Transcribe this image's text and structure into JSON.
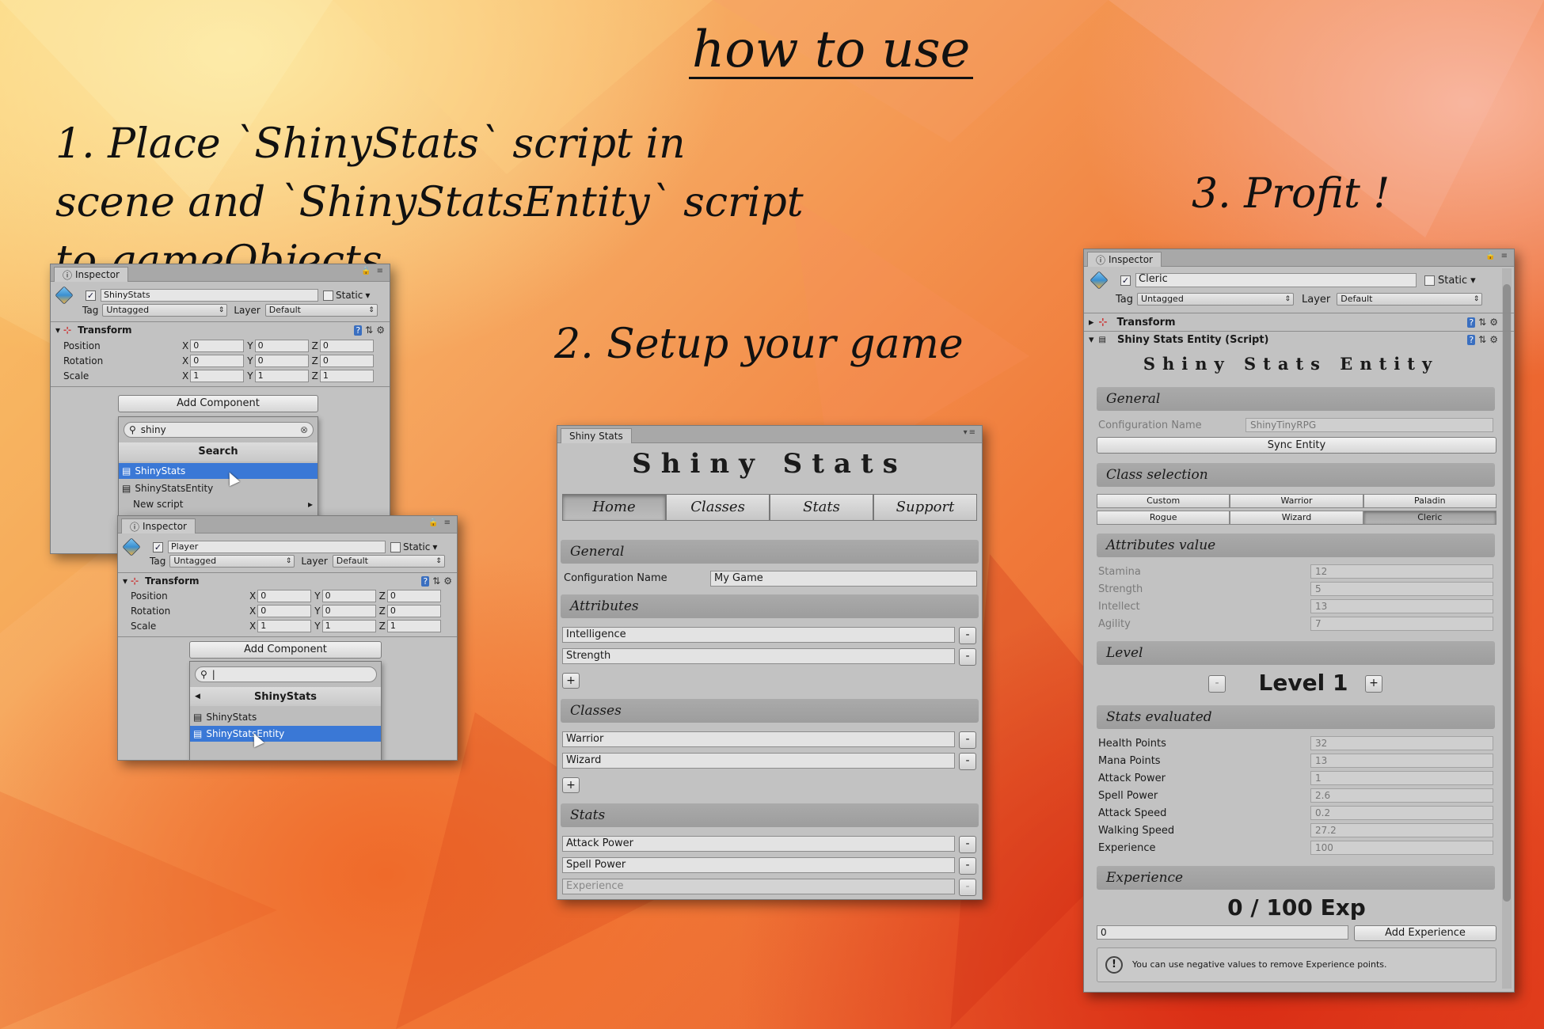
{
  "title": "how to use",
  "steps": {
    "step1": "1. Place `ShinyStats` script in scene and `ShinyStatsEntity` script to gameObjects",
    "step2": "2. Setup your game",
    "step3": "3. Profit !"
  },
  "inspector1": {
    "tab": "Inspector",
    "object_name": "ShinyStats",
    "static_label": "Static",
    "tag_label": "Tag",
    "tag_value": "Untagged",
    "layer_label": "Layer",
    "layer_value": "Default",
    "transform_label": "Transform",
    "position_label": "Position",
    "rotation_label": "Rotation",
    "scale_label": "Scale",
    "x": "X",
    "y": "Y",
    "z": "Z",
    "pos": [
      "0",
      "0",
      "0"
    ],
    "rot": [
      "0",
      "0",
      "0"
    ],
    "scale": [
      "1",
      "1",
      "1"
    ],
    "add_component": "Add Component",
    "search_value": "shiny",
    "search_header": "Search",
    "results": [
      "ShinyStats",
      "ShinyStatsEntity",
      "New script"
    ]
  },
  "inspector2": {
    "tab": "Inspector",
    "object_name": "Player",
    "static_label": "Static",
    "tag_label": "Tag",
    "tag_value": "Untagged",
    "layer_label": "Layer",
    "layer_value": "Default",
    "transform_label": "Transform",
    "position_label": "Position",
    "rotation_label": "Rotation",
    "scale_label": "Scale",
    "x": "X",
    "y": "Y",
    "z": "Z",
    "pos": [
      "0",
      "0",
      "0"
    ],
    "rot": [
      "0",
      "0",
      "0"
    ],
    "scale": [
      "1",
      "1",
      "1"
    ],
    "add_component": "Add Component",
    "search_value": "",
    "category": "ShinyStats",
    "results": [
      "ShinyStats",
      "ShinyStatsEntity"
    ]
  },
  "shiny_window": {
    "tab": "Shiny Stats",
    "heading": "Shiny Stats",
    "nav": [
      "Home",
      "Classes",
      "Stats",
      "Support"
    ],
    "general": "General",
    "config_label": "Configuration Name",
    "config_value": "My Game",
    "attributes": "Attributes",
    "attribute_items": [
      "Intelligence",
      "Strength"
    ],
    "classes": "Classes",
    "class_items": [
      "Warrior",
      "Wizard"
    ],
    "stats": "Stats",
    "stat_items": [
      "Attack Power",
      "Spell Power",
      "Experience"
    ],
    "minus": "-",
    "plus": "+"
  },
  "entity_inspector": {
    "tab": "Inspector",
    "object_name": "Cleric",
    "static_label": "Static",
    "tag_label": "Tag",
    "tag_value": "Untagged",
    "layer_label": "Layer",
    "layer_value": "Default",
    "transform_label": "Transform",
    "script_label": "Shiny Stats Entity (Script)",
    "heading": "Shiny Stats Entity",
    "general": "General",
    "config_label": "Configuration Name",
    "config_value": "ShinyTinyRPG",
    "sync": "Sync Entity",
    "class_selection": "Class selection",
    "class_options": [
      "Custom",
      "Warrior",
      "Paladin",
      "Rogue",
      "Wizard",
      "Cleric"
    ],
    "selected_class": "Cleric",
    "attributes_value": "Attributes value",
    "attribute_rows": [
      {
        "label": "Stamina",
        "value": "12"
      },
      {
        "label": "Strength",
        "value": "5"
      },
      {
        "label": "Intellect",
        "value": "13"
      },
      {
        "label": "Agility",
        "value": "7"
      }
    ],
    "level_header": "Level",
    "level_text": "Level 1",
    "minus": "-",
    "plus": "+",
    "stats_evaluated": "Stats evaluated",
    "stat_rows": [
      {
        "label": "Health Points",
        "value": "32"
      },
      {
        "label": "Mana Points",
        "value": "13"
      },
      {
        "label": "Attack Power",
        "value": "1"
      },
      {
        "label": "Spell Power",
        "value": "2.6"
      },
      {
        "label": "Attack Speed",
        "value": "0.2"
      },
      {
        "label": "Walking Speed",
        "value": "27.2"
      },
      {
        "label": "Experience",
        "value": "100"
      }
    ],
    "experience_header": "Experience",
    "exp_text": "0 / 100 Exp",
    "exp_input": "0",
    "add_exp": "Add Experience",
    "info": "You can use negative values to remove Experience points."
  },
  "colors": {
    "selection": "#3a78d6",
    "panel": "#c2c2c2",
    "header": "#a3a3a3"
  }
}
